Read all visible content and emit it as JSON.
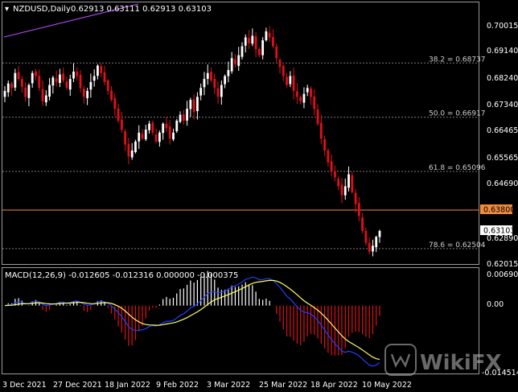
{
  "header": {
    "symbol": "NZDUSD,Daily",
    "ohlc": "0.62913 0.63111 0.62913 0.63103"
  },
  "macd": {
    "label": "MACD(12,26,9) -0.012605 -0.012316 0.000000 -0.000375",
    "axis_labels": [
      "0.006909",
      "0.00",
      "-0.014514"
    ]
  },
  "price_axis": {
    "labels": [
      "0.70015",
      "0.69140",
      "0.68240",
      "0.67340",
      "0.66465",
      "0.65565",
      "0.64690",
      "0.63790",
      "0.62890",
      "0.62015"
    ],
    "current_price": "0.63103",
    "hline_price": "0.63800"
  },
  "fibonacci": [
    {
      "label": "38.2 = 0.68737",
      "price": 0.68737
    },
    {
      "label": "50.0 = 0.66917",
      "price": 0.66917
    },
    {
      "label": "61.8 = 0.65096",
      "price": 0.65096
    },
    {
      "label": "78.6 = 0.62504",
      "price": 0.62504
    }
  ],
  "time_axis": {
    "labels": [
      "3 Dec 2021",
      "27 Dec 2021",
      "18 Jan 2022",
      "9 Feb 2022",
      "3 Mar 2022",
      "25 Mar 2022",
      "18 Apr 2022",
      "10 May 2022"
    ]
  },
  "watermark": "WikiFX",
  "colors": {
    "background": "#000000",
    "bull": "#ffffff",
    "bear": "#e0101a",
    "fib_line": "#7a7a7a",
    "hline": "#f08a3c",
    "price_badge": "#f08a3c",
    "macd_line": "#1d3fff",
    "signal_line": "#ffff66",
    "hist_pos": "#ffffff",
    "hist_neg": "#e0101a",
    "trendline": "#b64cff"
  },
  "chart_data": {
    "type": "candlestick",
    "closes": [
      0.678,
      0.6805,
      0.679,
      0.684,
      0.682,
      0.6795,
      0.676,
      0.68,
      0.684,
      0.683,
      0.679,
      0.6745,
      0.6765,
      0.68,
      0.6825,
      0.681,
      0.6835,
      0.6815,
      0.679,
      0.682,
      0.6845,
      0.683,
      0.679,
      0.676,
      0.678,
      0.681,
      0.683,
      0.6865,
      0.684,
      0.681,
      0.678,
      0.675,
      0.672,
      0.668,
      0.665,
      0.66,
      0.656,
      0.658,
      0.661,
      0.664,
      0.662,
      0.665,
      0.667,
      0.664,
      0.661,
      0.664,
      0.667,
      0.6655,
      0.662,
      0.664,
      0.668,
      0.67,
      0.668,
      0.672,
      0.675,
      0.671,
      0.676,
      0.679,
      0.682,
      0.684,
      0.6815,
      0.679,
      0.676,
      0.68,
      0.683,
      0.685,
      0.689,
      0.687,
      0.69,
      0.693,
      0.696,
      0.694,
      0.6965,
      0.692,
      0.69,
      0.695,
      0.698,
      0.696,
      0.693,
      0.689,
      0.686,
      0.683,
      0.68,
      0.683,
      0.678,
      0.676,
      0.6745,
      0.677,
      0.679,
      0.676,
      0.672,
      0.667,
      0.662,
      0.658,
      0.654,
      0.651,
      0.649,
      0.646,
      0.643,
      0.646,
      0.65,
      0.644,
      0.64,
      0.636,
      0.631,
      0.627,
      0.624,
      0.626,
      0.629,
      0.631
    ]
  }
}
